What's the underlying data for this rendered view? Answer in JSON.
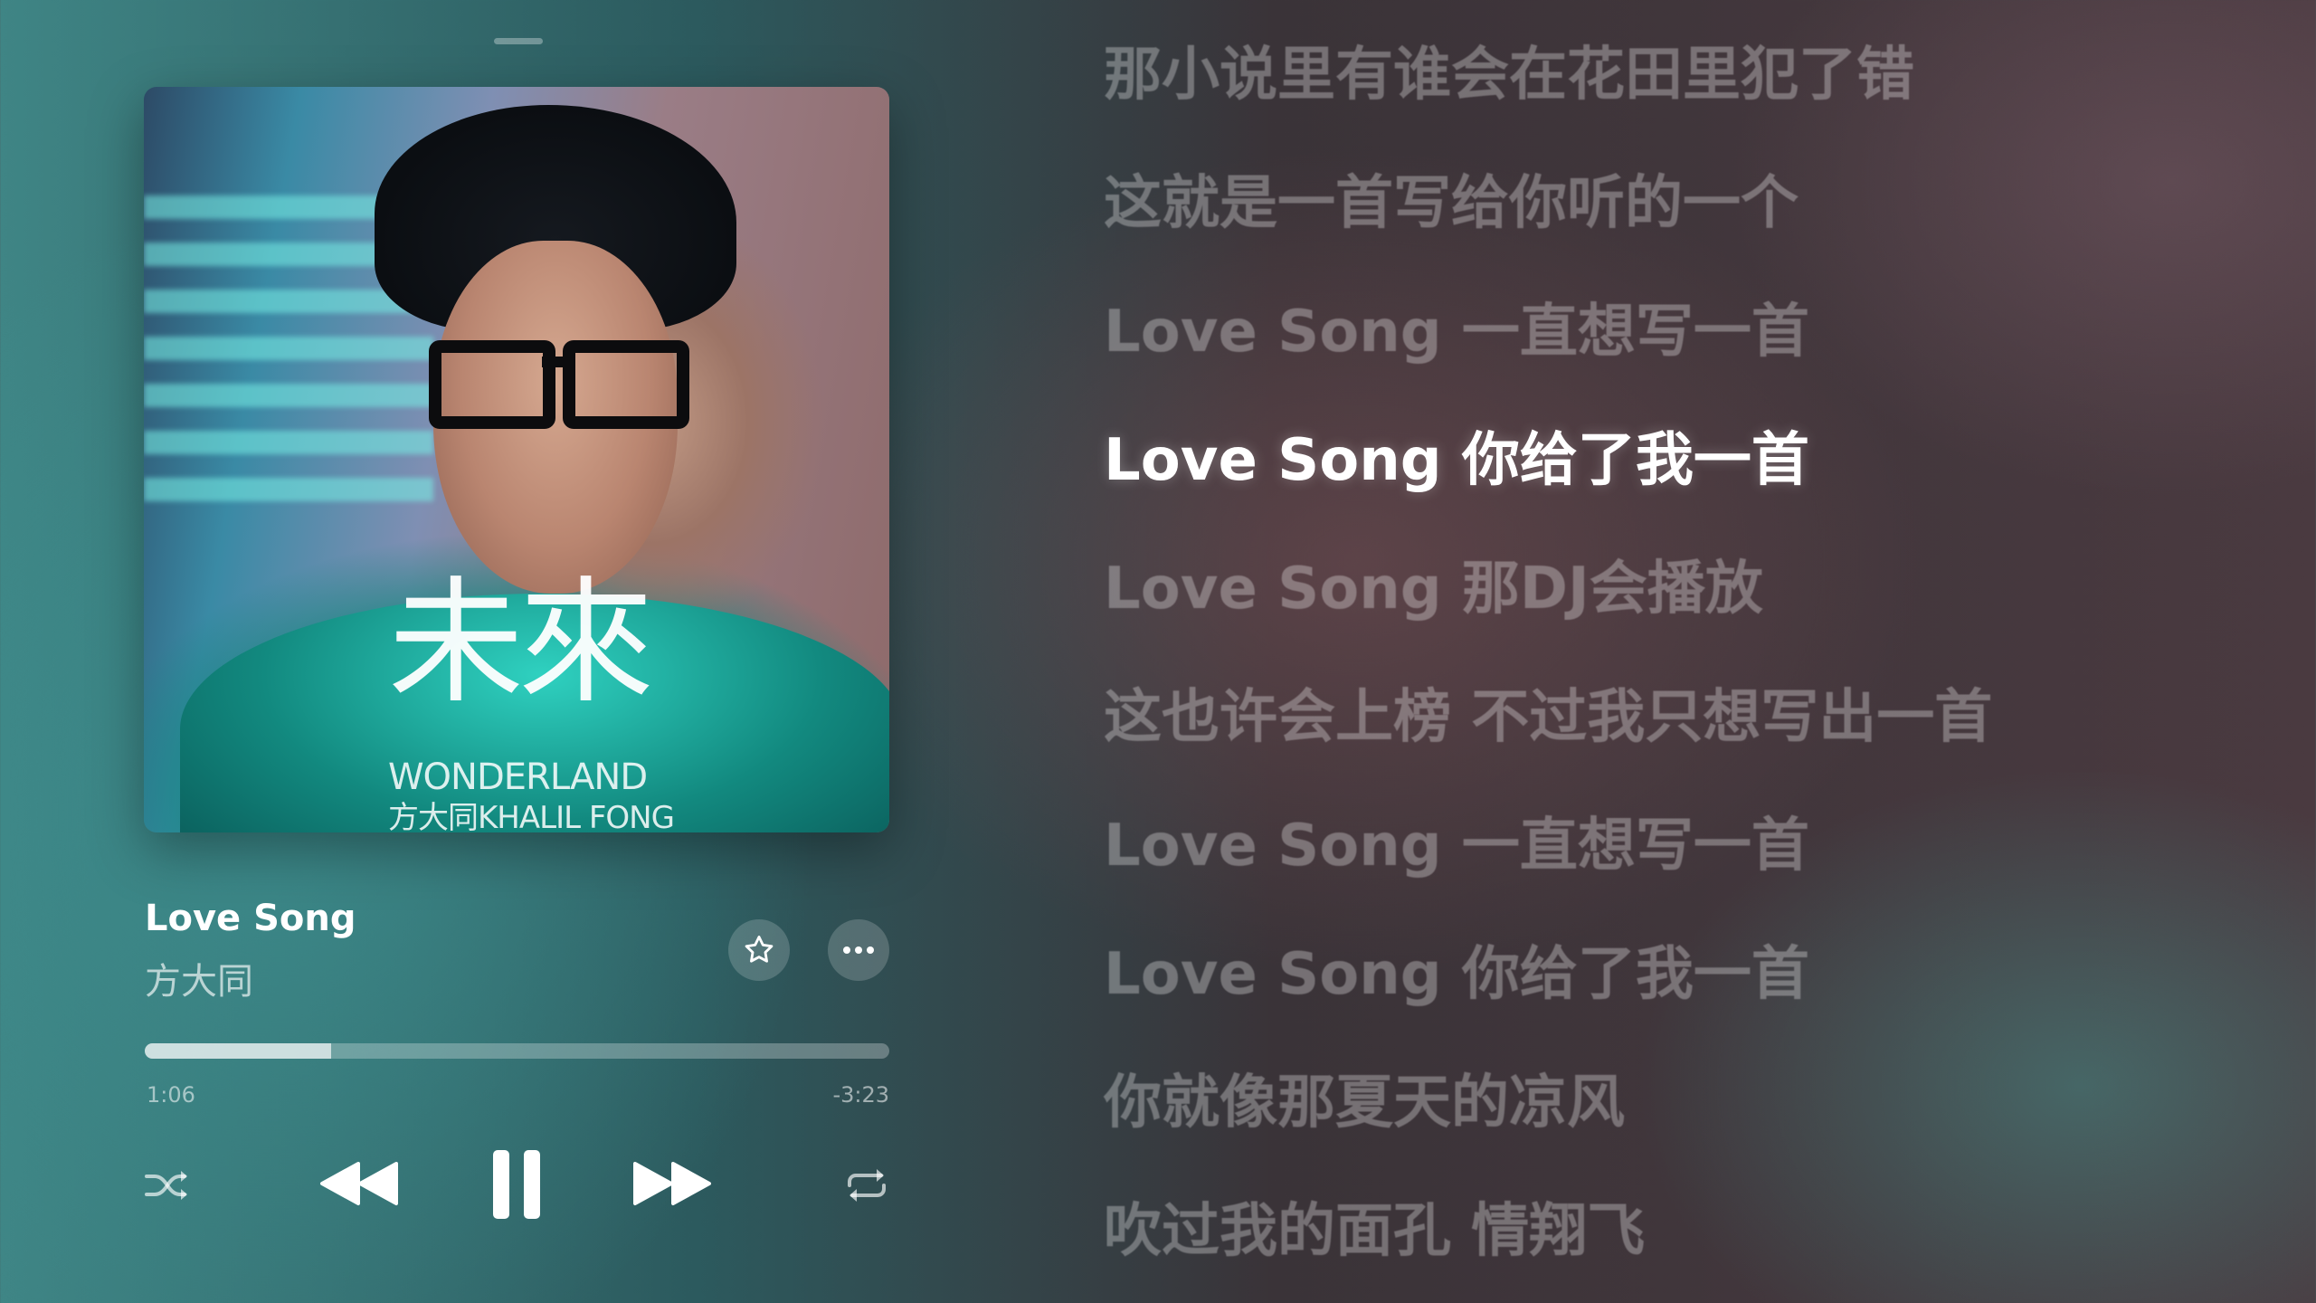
{
  "album": {
    "cover_title": "未來",
    "cover_subtitle": "WONDERLAND",
    "cover_artist": "方大同KHALIL FONG"
  },
  "now_playing": {
    "title": "Love Song",
    "artist": "方大同",
    "elapsed": "1:06",
    "remaining": "-3:23",
    "progress_fraction": 0.25
  },
  "icons": {
    "favorite": "star-icon",
    "more": "ellipsis-icon",
    "shuffle": "shuffle-icon",
    "previous": "rewind-icon",
    "play_pause": "pause-icon",
    "next": "fast-forward-icon",
    "repeat": "repeat-icon"
  },
  "lyrics": {
    "current_index": 3,
    "lines": [
      "那小说里有谁会在花田里犯了错",
      "这就是一首写给你听的一个",
      "Love Song 一直想写一首",
      "Love Song 你给了我一首",
      "Love Song 那DJ会播放",
      "这也许会上榜 不过我只想写出一首",
      "Love Song 一直想写一首",
      "Love Song 你给了我一首",
      "你就像那夏天的凉风",
      "吹过我的面孔 情翔飞"
    ]
  }
}
